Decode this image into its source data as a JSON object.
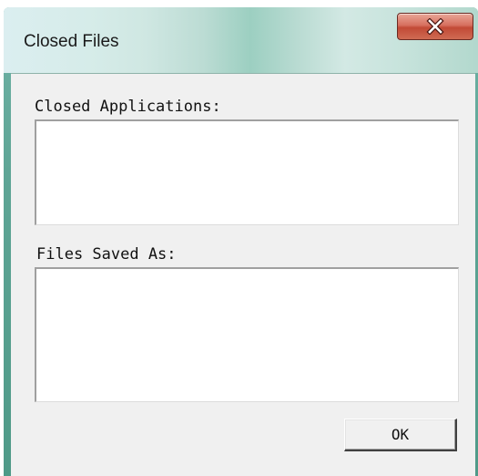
{
  "window": {
    "title": "Closed Files",
    "close_icon": "close-icon"
  },
  "closed_applications": {
    "label": "Closed Applications:",
    "items": []
  },
  "files_saved_as": {
    "label": "Files Saved As:",
    "items": []
  },
  "buttons": {
    "ok_label": "OK"
  },
  "colors": {
    "frame": "#5fa596",
    "close_button": "#c24a36",
    "client_background": "#f0f0f0"
  }
}
